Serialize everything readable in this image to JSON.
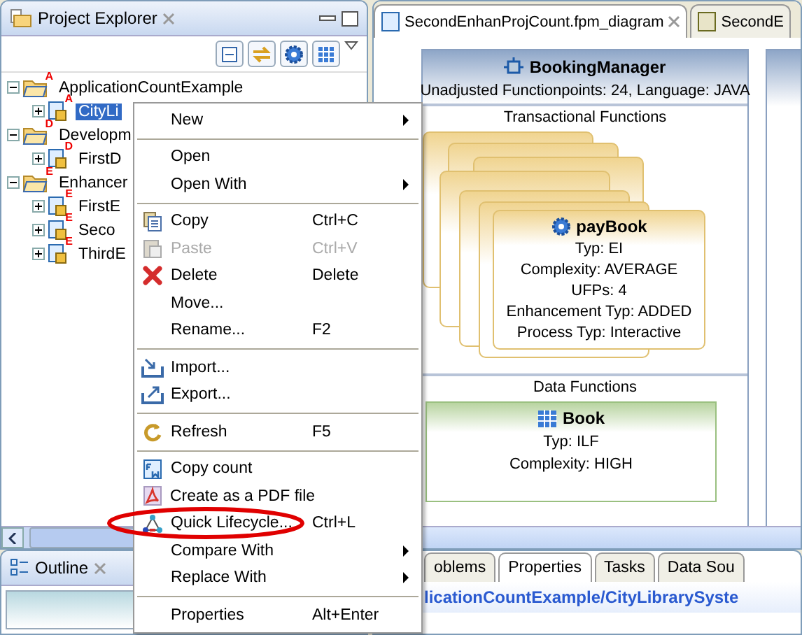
{
  "explorer": {
    "title": "Project Explorer",
    "tree": [
      {
        "label": "ApplicationCountExample",
        "badge": "A",
        "kind": "folder",
        "expanded": true,
        "children": [
          {
            "label": "CityLi",
            "badge": "A",
            "kind": "file",
            "selected": true,
            "expanded": false
          }
        ]
      },
      {
        "label": "Developm",
        "badge": "D",
        "kind": "folder",
        "expanded": true,
        "children": [
          {
            "label": "FirstD",
            "badge": "D",
            "kind": "file",
            "selected": false,
            "expanded": false
          }
        ]
      },
      {
        "label": "Enhancer",
        "badge": "E",
        "kind": "folder",
        "expanded": true,
        "children": [
          {
            "label": "FirstE",
            "badge": "E",
            "kind": "file",
            "selected": false,
            "expanded": false
          },
          {
            "label": "Seco",
            "badge": "E",
            "kind": "file",
            "selected": false,
            "expanded": false
          },
          {
            "label": "ThirdE",
            "badge": "E",
            "kind": "file",
            "selected": false,
            "expanded": false
          }
        ]
      }
    ]
  },
  "outline": {
    "title": "Outline"
  },
  "editor_tabs": [
    {
      "label": "SecondEnhanProjCount.fpm_diagram",
      "selected": true
    },
    {
      "label": "SecondE",
      "selected": false
    }
  ],
  "diagram": {
    "component": {
      "title": "BookingManager",
      "subtitle": "Unadjusted Functionpoints: 24, Language: JAVA",
      "sections": [
        "Transactional Functions",
        "Data Functions"
      ]
    },
    "transaction": {
      "title": "payBook",
      "lines": [
        "Typ: EI",
        "Complexity: AVERAGE",
        "UFPs: 4",
        "Enhancement Typ: ADDED",
        "Process Typ: Interactive"
      ]
    },
    "data_function": {
      "title": "Book",
      "lines": [
        "Typ: ILF",
        "Complexity: HIGH"
      ]
    }
  },
  "context_menu": [
    {
      "kind": "item",
      "label": "New",
      "submenu": true
    },
    {
      "kind": "separator"
    },
    {
      "kind": "item",
      "label": "Open"
    },
    {
      "kind": "item",
      "label": "Open With",
      "submenu": true
    },
    {
      "kind": "separator"
    },
    {
      "kind": "item",
      "label": "Copy",
      "shortcut": "Ctrl+C"
    },
    {
      "kind": "item",
      "label": "Paste",
      "shortcut": "Ctrl+V",
      "disabled": true
    },
    {
      "kind": "item",
      "label": "Delete",
      "shortcut": "Delete"
    },
    {
      "kind": "item",
      "label": "Move..."
    },
    {
      "kind": "item",
      "label": "Rename...",
      "shortcut": "F2"
    },
    {
      "kind": "separator"
    },
    {
      "kind": "item",
      "label": "Import..."
    },
    {
      "kind": "item",
      "label": "Export..."
    },
    {
      "kind": "separator"
    },
    {
      "kind": "item",
      "label": "Refresh",
      "shortcut": "F5"
    },
    {
      "kind": "separator"
    },
    {
      "kind": "item",
      "label": "Copy count"
    },
    {
      "kind": "item",
      "label": "Create as a PDF file"
    },
    {
      "kind": "item",
      "label": "Quick Lifecycle...",
      "shortcut": "Ctrl+L",
      "circled": true
    },
    {
      "kind": "item",
      "label": "Compare With",
      "submenu": true
    },
    {
      "kind": "item",
      "label": "Replace With",
      "submenu": true
    },
    {
      "kind": "separator"
    },
    {
      "kind": "item",
      "label": "Properties",
      "shortcut": "Alt+Enter"
    }
  ],
  "bottom_tabs": [
    {
      "label": "oblems",
      "selected": false
    },
    {
      "label": "Properties",
      "selected": true
    },
    {
      "label": "Tasks",
      "selected": false
    },
    {
      "label": "Data Sou",
      "selected": false
    }
  ],
  "properties_path": "licationCountExample/CityLibrarySyste"
}
